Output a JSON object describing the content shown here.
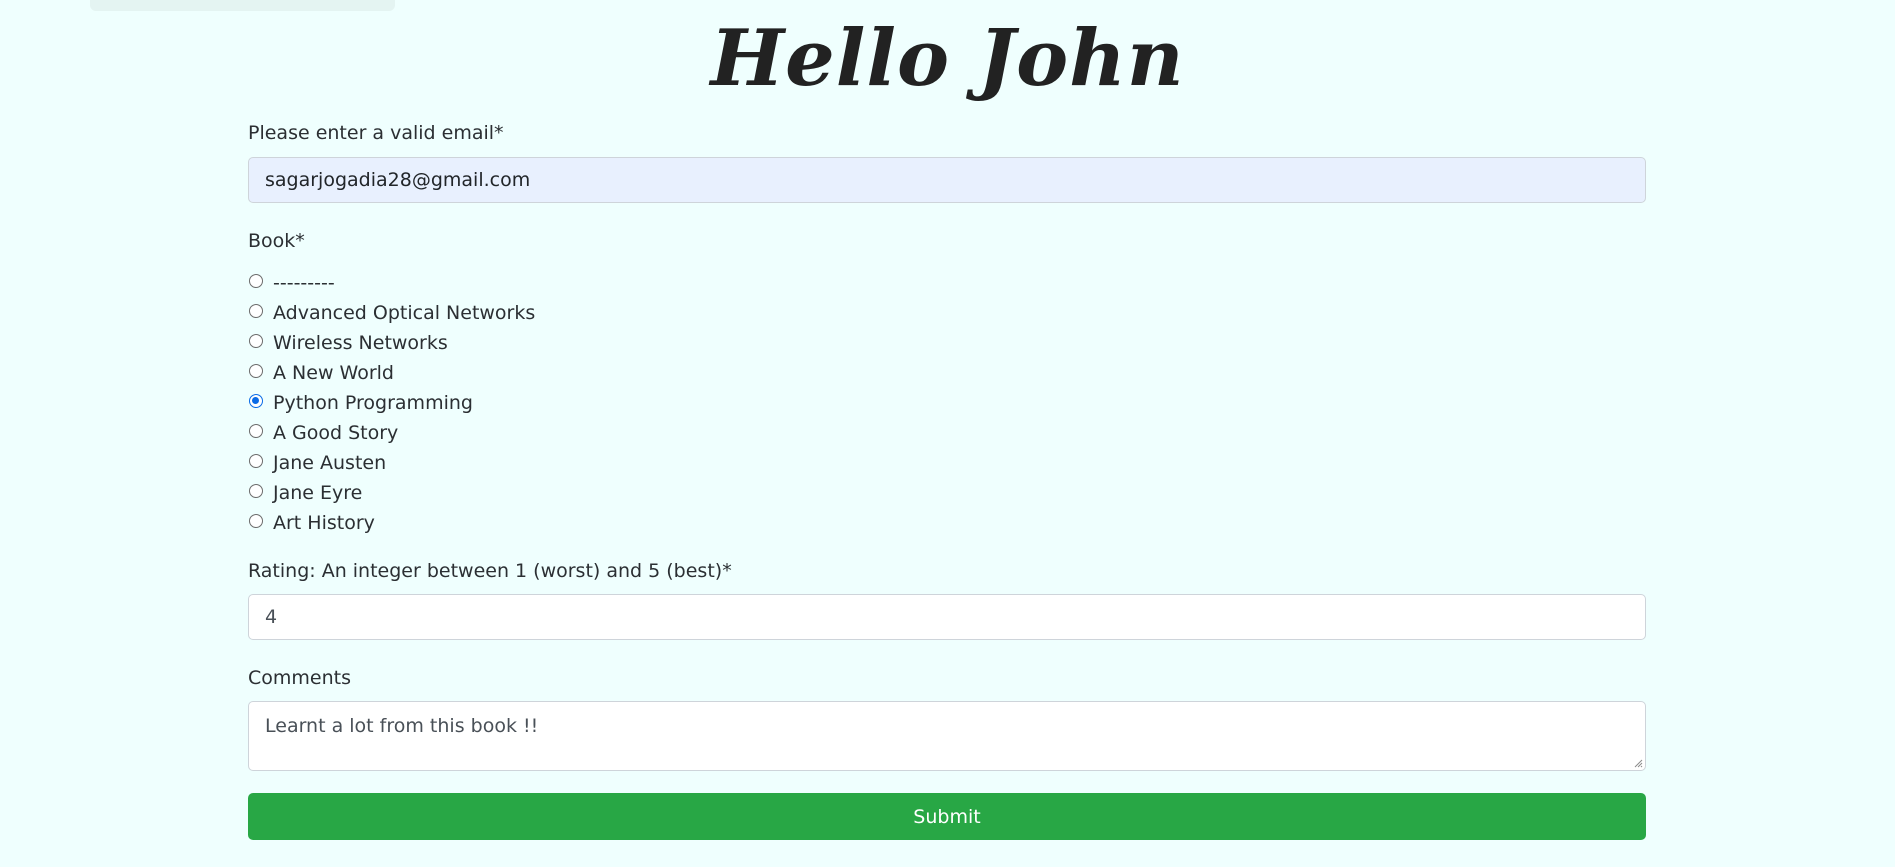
{
  "page": {
    "title": "Hello John"
  },
  "form": {
    "email": {
      "label": "Please enter a valid email*",
      "value": "sagarjogadia28@gmail.com"
    },
    "book": {
      "label": "Book*",
      "options": [
        {
          "label": "---------",
          "checked": false
        },
        {
          "label": "Advanced Optical Networks",
          "checked": false
        },
        {
          "label": "Wireless Networks",
          "checked": false
        },
        {
          "label": "A New World",
          "checked": false
        },
        {
          "label": "Python Programming",
          "checked": true
        },
        {
          "label": "A Good Story",
          "checked": false
        },
        {
          "label": "Jane Austen",
          "checked": false
        },
        {
          "label": "Jane Eyre",
          "checked": false
        },
        {
          "label": "Art History",
          "checked": false
        }
      ]
    },
    "rating": {
      "label": "Rating: An integer between 1 (worst) and 5 (best)*",
      "value": "4"
    },
    "comments": {
      "label": "Comments",
      "value": "Learnt a lot from this book !!"
    },
    "submit_label": "Submit"
  },
  "colors": {
    "background": "#effffe",
    "submit": "#28a745",
    "radio_checked": "#0a6be6",
    "email_fill": "#e8f0fe"
  }
}
